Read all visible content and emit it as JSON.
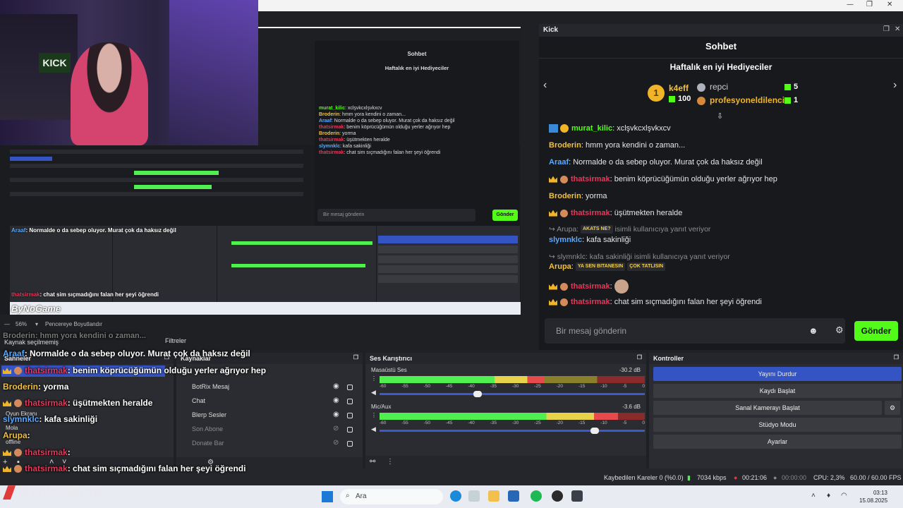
{
  "window": {
    "controls": [
      "—",
      "❐",
      "✕"
    ]
  },
  "chat": {
    "panel_title": "Kick",
    "title": "Sohbet",
    "gifters_title": "Haftalık en iyi Hediyeciler",
    "gifters": [
      {
        "rank": "1",
        "name": "k4eff",
        "count": "100"
      },
      {
        "name": "repci",
        "count": "5"
      },
      {
        "name": "profesyoneldilenci",
        "count": "1"
      }
    ],
    "messages": [
      {
        "user": "murat_kilic",
        "text": ": xclşvkcxlşvkxcv",
        "color": "#53fc18"
      },
      {
        "user": "Broderin",
        "text": ": hmm yora kendini o zaman...",
        "color": "#f0c040"
      },
      {
        "user": "Araaf",
        "text": ": Normalde o da sebep oluyor. Murat çok da haksız değil",
        "color": "#5aa9ff"
      },
      {
        "user": "thatsirmak",
        "text": ": benim köprücüğümün olduğu yerler ağrıyor hep",
        "color": "#e23a5a"
      },
      {
        "user": "Broderin",
        "text": ": yorma",
        "color": "#f0c040"
      },
      {
        "user": "thatsirmak",
        "text": ": üşütmekten heralde",
        "color": "#e23a5a"
      },
      {
        "reply": "↪ Arupa:",
        "reply_tail": "isimli kullanıcıya yanıt veriyor"
      },
      {
        "user": "slymnklc",
        "text": ": kafa sakinliği",
        "color": "#5aa9ff"
      },
      {
        "reply": "↪ slymnklc: kafa sakinliği isimli kullanıcıya yanıt veriyor"
      },
      {
        "user": "Arupa",
        "text": ":",
        "color": "#f0c040"
      },
      {
        "user": "thatsirmak",
        "text": ":",
        "color": "#e23a5a"
      },
      {
        "user": "thatsirmak",
        "text": ": chat sim sıçmadığını falan her şeyi öğrendi",
        "color": "#e23a5a"
      }
    ],
    "sticker1": "AKATS NE?",
    "sticker2": "YA SEN BITANESIN",
    "sticker3": "ÇOK TATLISIN",
    "input_placeholder": "Bir mesaj gönderin",
    "send_label": "Gönder"
  },
  "obs": {
    "zoom": "56%",
    "fit": "Pencereye Boyutlandır",
    "source_select": "Kaynak seçilmemiş",
    "filters": "Filtreler",
    "scenes_title": "Sahneler",
    "sources_title": "Kaynaklar",
    "sources": [
      "BotRix Mesaj",
      "Chat",
      "Blerp Sesler",
      "Son Abone",
      "Donate Bar"
    ],
    "mixer_title": "Ses Karıştırıcı",
    "channels": [
      {
        "name": "Masaüstü Ses",
        "db": "-30.2 dB",
        "level": 0.62,
        "volume": 0.37
      },
      {
        "name": "Mic/Aux",
        "db": "-3.6 dB",
        "level": 0.9,
        "volume": 0.81
      }
    ],
    "ticks": [
      "-60",
      "-55",
      "-50",
      "-45",
      "-40",
      "-35",
      "-30",
      "-25",
      "-20",
      "-15",
      "-10",
      "-5",
      "0"
    ],
    "controls_title": "Kontroller",
    "controls": [
      "Yayını Durdur",
      "Kaydı Başlat",
      "Sanal Kamerayı Başlat",
      "Stüdyo Modu",
      "Ayarlar"
    ],
    "status": {
      "dropped": "Kaybedilen Kareler 0 (%0.0)",
      "bitrate": "7034 kbps",
      "live": "00:21:06",
      "rec": "00:00:00",
      "cpu": "CPU: 2,3%",
      "fps": "60.00 / 60.00 FPS"
    }
  },
  "overlay": {
    "lines": [
      {
        "user": "Broderin",
        "text": ": hmm yora kendini o zaman..."
      },
      {
        "user": "Araaf",
        "text": ": Normalde o da sebep oluyor. Murat çok da haksız değil"
      },
      {
        "user": "thatsirmak",
        "text": ": benim köprücüğümün olduğu yerler ağrıyor hep"
      },
      {
        "user": "Broderin",
        "text": ": yorma"
      },
      {
        "user": "thatsirmak",
        "text": ": üşütmekten heralde"
      },
      {
        "user": "slymnklc",
        "text": ": kafa sakinliği"
      },
      {
        "user": "Arupa",
        "text": ":"
      },
      {
        "user": "thatsirmak",
        "text": ":"
      },
      {
        "user": "thatsirmak",
        "text": ": chat sim sıçmadığını falan her şeyi öğrendi"
      }
    ],
    "scene_labels": [
      "Oyun Ekranı",
      "Mola",
      "offline"
    ],
    "brand": "ByNoGame"
  },
  "taskbar": {
    "search": "Ara",
    "time": "03:13",
    "date": "15.08.2025"
  }
}
